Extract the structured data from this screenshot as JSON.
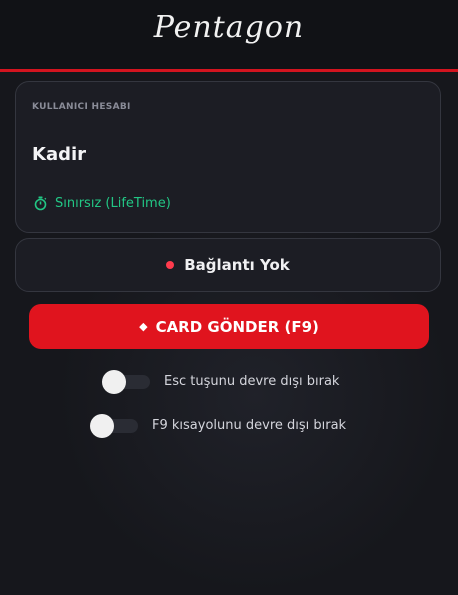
{
  "app": {
    "title": "Pentagon",
    "accent_color": "#d3141f"
  },
  "account": {
    "section_label": "KULLANICI HESABI",
    "username": "Kadir",
    "license_icon": "stopwatch-icon",
    "license_text": "Sınırsız (LifeTime)",
    "license_color": "#22c785"
  },
  "connection": {
    "status_text": "Bağlantı Yok",
    "status_color": "#ff3b4d"
  },
  "send_button": {
    "icon": "diamond-icon",
    "label": "CARD GÖNDER (F9)"
  },
  "settings": {
    "esc_toggle": {
      "label": "Esc tuşunu devre dışı bırak",
      "enabled": false
    },
    "f9_toggle": {
      "label": "F9 kısayolunu devre dışı bırak",
      "enabled": false
    }
  }
}
